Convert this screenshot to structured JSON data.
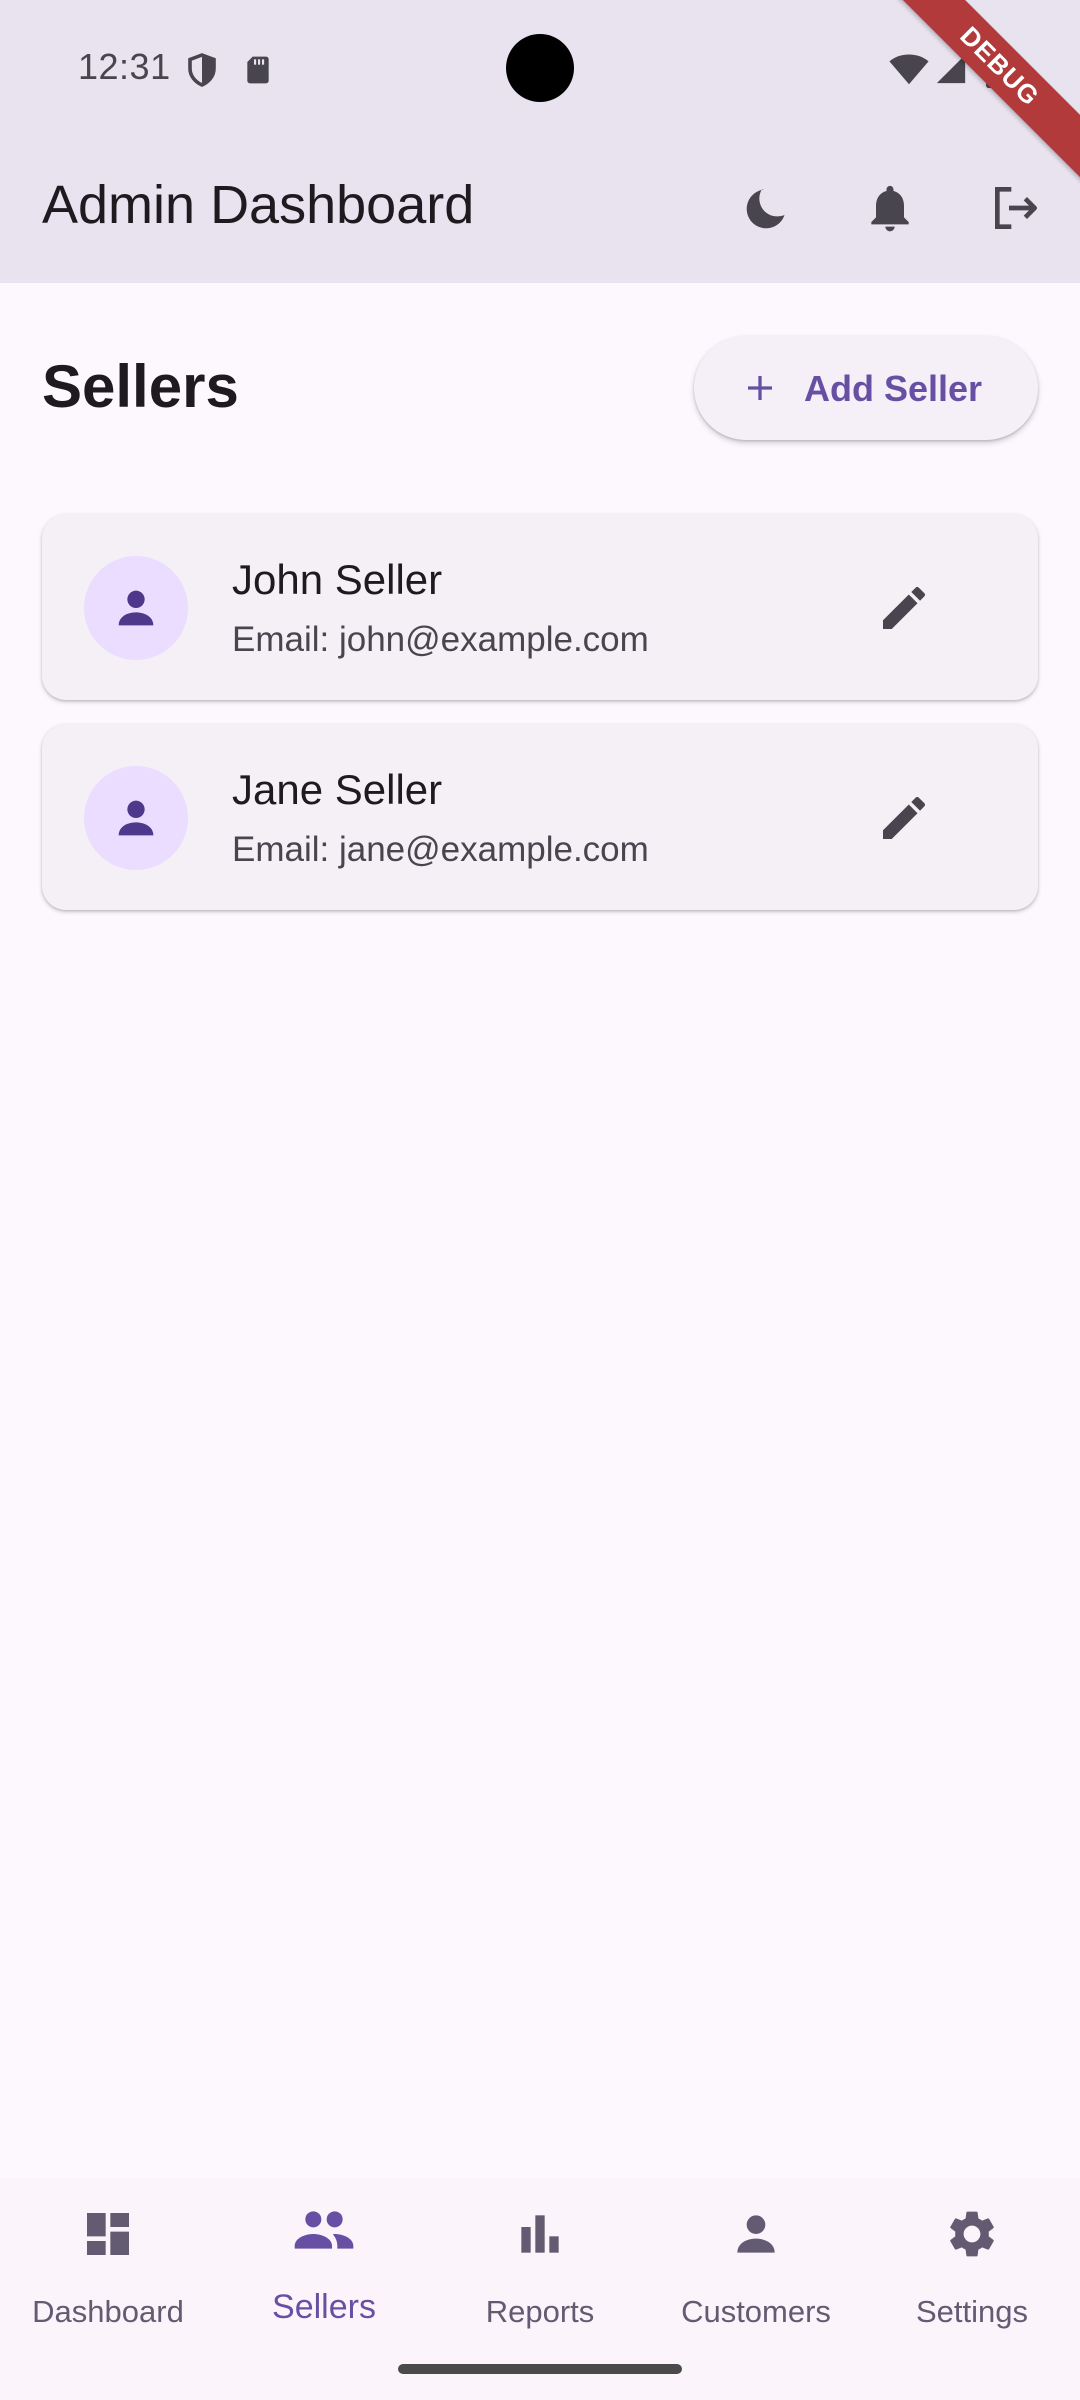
{
  "status_bar": {
    "time": "12:31",
    "debug_label": "DEBUG"
  },
  "app_bar": {
    "title": "Admin Dashboard",
    "icons": [
      "dark-mode-icon",
      "notifications-icon",
      "logout-icon"
    ]
  },
  "sellers_section": {
    "title": "Sellers",
    "add_button_label": "Add Seller"
  },
  "sellers": [
    {
      "name": "John Seller",
      "email": "Email: john@example.com"
    },
    {
      "name": "Jane Seller",
      "email": "Email: jane@example.com"
    }
  ],
  "bottom_nav": {
    "active": "Sellers",
    "items": [
      {
        "label": "Dashboard",
        "icon": "dashboard-icon"
      },
      {
        "label": "Sellers",
        "icon": "people-icon"
      },
      {
        "label": "Reports",
        "icon": "bar-chart-icon"
      },
      {
        "label": "Customers",
        "icon": "person-icon"
      },
      {
        "label": "Settings",
        "icon": "gear-icon"
      }
    ]
  },
  "colors": {
    "primary": "#6750a4",
    "app_bar_bg": "#e9e3f0",
    "page_bg": "#fdf7fe",
    "card_bg": "#f5f0f6",
    "avatar_bg": "#eaddff",
    "avatar_icon": "#4f378b",
    "debug_ribbon": "#b23a3a"
  }
}
